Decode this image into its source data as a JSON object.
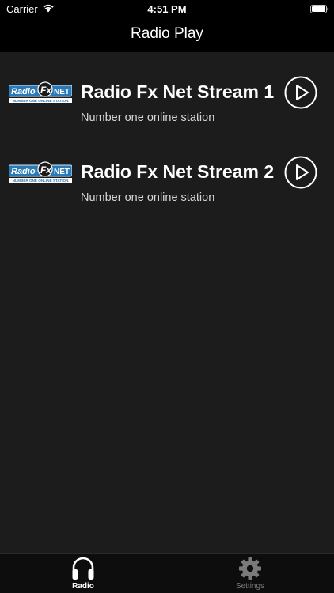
{
  "status_bar": {
    "carrier": "Carrier",
    "time": "4:51 PM",
    "icons": [
      "wifi-icon",
      "battery-icon"
    ]
  },
  "nav": {
    "title": "Radio Play"
  },
  "stations": [
    {
      "title": "Radio Fx Net Stream 1",
      "subtitle": "Number one online station",
      "logo_text": "RadioFx NET",
      "logo_tagline": "NUMBER ONE ONLINE STATION",
      "icon": "play-icon"
    },
    {
      "title": "Radio Fx Net Stream 2",
      "subtitle": "Number one online station",
      "logo_text": "RadioFx NET",
      "logo_tagline": "NUMBER ONE ONLINE STATION",
      "icon": "play-icon"
    }
  ],
  "tab_bar": {
    "tabs": [
      {
        "label": "Radio",
        "icon": "headphones-icon",
        "selected": true
      },
      {
        "label": "Settings",
        "icon": "gear-icon",
        "selected": false
      }
    ]
  },
  "colors": {
    "background": "#1c1c1c",
    "bars": "#000000",
    "logo_blue": "#2a7ab8",
    "tab_active": "#ffffff",
    "tab_inactive": "#7a7a7a"
  }
}
